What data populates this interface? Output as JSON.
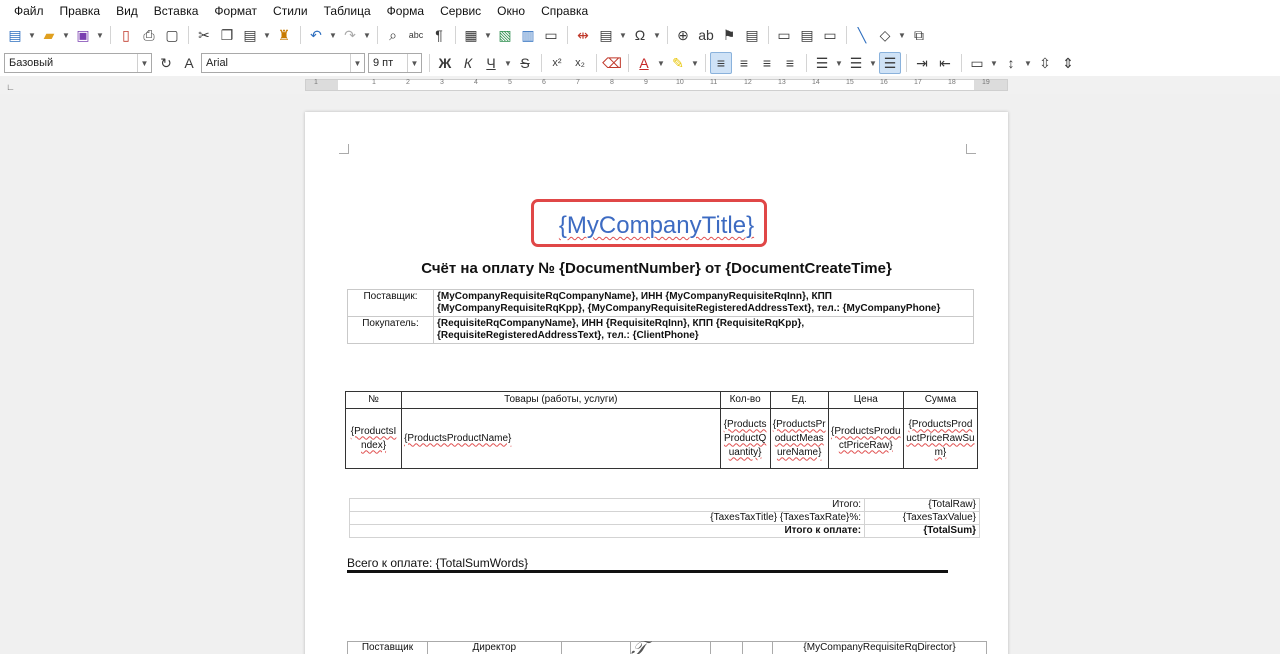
{
  "menu": [
    "Файл",
    "Правка",
    "Вид",
    "Вставка",
    "Формат",
    "Стили",
    "Таблица",
    "Форма",
    "Сервис",
    "Окно",
    "Справка"
  ],
  "toolbar2": {
    "paragraph_style": "Базовый",
    "font_name": "Arial",
    "font_size": "9 пт",
    "bold": "Ж",
    "italic": "К",
    "underline": "Ч",
    "strike": "S",
    "superscript": "x²",
    "subscript": "x₂"
  },
  "ruler": {
    "labels": [
      "1",
      "1",
      "2",
      "3",
      "4",
      "5",
      "6",
      "7",
      "8",
      "9",
      "10",
      "11",
      "12",
      "13",
      "14",
      "15",
      "16",
      "17",
      "18",
      "19"
    ]
  },
  "document": {
    "company_title": "{MyCompanyTitle}",
    "heading": "Счёт на оплату № {DocumentNumber} от {DocumentCreateTime}",
    "parties": [
      {
        "label": "Поставщик:",
        "value": "{MyCompanyRequisiteRqCompanyName}, ИНН {MyCompanyRequisiteRqInn}, КПП {MyCompanyRequisiteRqKpp}, {MyCompanyRequisiteRegisteredAddressText}, тел.: {MyCompanyPhone}"
      },
      {
        "label": "Покупатель:",
        "value": "{RequisiteRqCompanyName}, ИНН {RequisiteRqInn}, КПП {RequisiteRqKpp}, {RequisiteRegisteredAddressText}, тел.: {ClientPhone}"
      }
    ],
    "products_headers": [
      "№",
      "Товары (работы, услуги)",
      "Кол-во",
      "Ед.",
      "Цена",
      "Сумма"
    ],
    "products_row": {
      "index": "{ProductsIndex}",
      "name": "{ProductsProductName}",
      "quantity": "{ProductsProductQuantity}",
      "measure": "{ProductsProductMeasureName}",
      "price": "{ProductsProductPriceRaw}",
      "sum": "{ProductsProductPriceRawSum}"
    },
    "totals": [
      {
        "label": "Итого:",
        "value": "{TotalRaw}",
        "bold": false
      },
      {
        "label": "{TaxesTaxTitle} {TaxesTaxRate}%:",
        "value": "{TaxesTaxValue}",
        "bold": false
      },
      {
        "label": "Итого к оплате:",
        "value": "{TotalSum}",
        "bold": true
      }
    ],
    "total_words": "Всего к оплате: {TotalSumWords}",
    "sign_row": {
      "supplier": "Поставщик",
      "director": "Директор",
      "director_name": "{MyCompanyRequisiteRqDirector}"
    }
  }
}
